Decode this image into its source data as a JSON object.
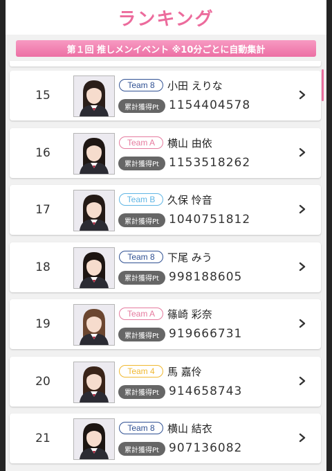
{
  "header": {
    "title": "ランキング"
  },
  "event": {
    "banner": "第１回 推しメンイベント ※10分ごとに自動集計"
  },
  "colors": {
    "accent": "#ec6b9c",
    "team_8": "#2e4f92",
    "team_a": "#e57a9e",
    "team_b": "#5fb5e4",
    "team_4": "#f0b830"
  },
  "rankings": [
    {
      "rank": "15",
      "team": "Team 8",
      "team_color": "#2e4f92",
      "name": "小田 えりな",
      "pt_label": "累計獲得Pt",
      "points": "1154404578",
      "hair": "#2a1e19"
    },
    {
      "rank": "16",
      "team": "Team A",
      "team_color": "#e57a9e",
      "name": "横山 由依",
      "pt_label": "累計獲得Pt",
      "points": "1153518262",
      "hair": "#1f1714"
    },
    {
      "rank": "17",
      "team": "Team B",
      "team_color": "#5fb5e4",
      "name": "久保 怜音",
      "pt_label": "累計獲得Pt",
      "points": "1040751812",
      "hair": "#241a16"
    },
    {
      "rank": "18",
      "team": "Team 8",
      "team_color": "#2e4f92",
      "name": "下尾 みう",
      "pt_label": "累計獲得Pt",
      "points": "998188605",
      "hair": "#1d1512"
    },
    {
      "rank": "19",
      "team": "Team A",
      "team_color": "#e57a9e",
      "name": "篠崎 彩奈",
      "pt_label": "累計獲得Pt",
      "points": "919666731",
      "hair": "#6b4630"
    },
    {
      "rank": "20",
      "team": "Team 4",
      "team_color": "#f0b830",
      "name": "馬 嘉伶",
      "pt_label": "累計獲得Pt",
      "points": "914658743",
      "hair": "#3a2419"
    },
    {
      "rank": "21",
      "team": "Team 8",
      "team_color": "#2e4f92",
      "name": "横山 結衣",
      "pt_label": "累計獲得Pt",
      "points": "907136082",
      "hair": "#1c1512"
    }
  ]
}
